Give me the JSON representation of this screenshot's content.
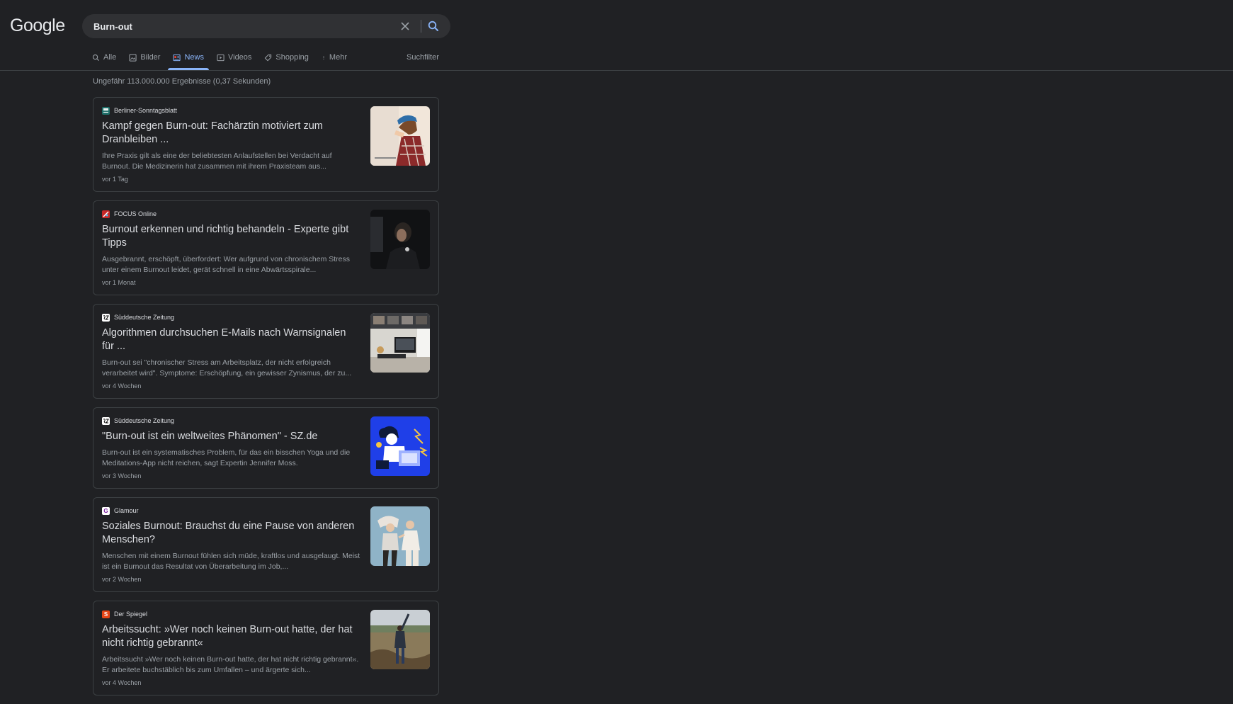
{
  "logo": "Google",
  "search": {
    "value": "Burn-out"
  },
  "tabs": [
    {
      "label": "Alle",
      "icon": "search-icon",
      "active": false
    },
    {
      "label": "Bilder",
      "icon": "image-icon",
      "active": false
    },
    {
      "label": "News",
      "icon": "news-icon",
      "active": true
    },
    {
      "label": "Videos",
      "icon": "play-icon",
      "active": false
    },
    {
      "label": "Shopping",
      "icon": "tag-icon",
      "active": false
    },
    {
      "label": "Mehr",
      "icon": "more-vert-icon",
      "active": false
    }
  ],
  "filter_label": "Suchfilter",
  "result_stats": "Ungefähr 113.000.000 Ergebnisse (0,37 Sekunden)",
  "colors": {
    "accent": "#8ab4f8",
    "background": "#202124",
    "card_border": "#3c4043"
  },
  "results": [
    {
      "source": "Berliner-Sonntagsblatt",
      "favicon_color": "#2a6f6a",
      "favicon_glyph": "",
      "title": "Kampf gegen Burn-out: Fachärztin motiviert zum Dranbleiben ...",
      "snippet": "Ihre Praxis gilt als eine der beliebtesten Anlaufstellen bei Verdacht auf Burnout. Die Medizinerin hat zusammen mit ihrem Praxisteam aus...",
      "date": "vor 1 Tag"
    },
    {
      "source": "FOCUS Online",
      "favicon_color": "#c62828",
      "favicon_glyph": "",
      "title": "Burnout erkennen und richtig behandeln - Experte gibt Tipps",
      "snippet": "Ausgebrannt, erschöpft, überfordert: Wer aufgrund von chronischem Stress unter einem Burnout leidet, gerät schnell in eine Abwärtsspirale...",
      "date": "vor 1 Monat"
    },
    {
      "source": "Süddeutsche Zeitung",
      "favicon_color": "#ffffff",
      "favicon_glyph": "",
      "title": "Algorithmen durchsuchen E-Mails nach Warnsignalen für ...",
      "snippet": "Burn-out sei \"chronischer Stress am Arbeitsplatz, der nicht erfolgreich verarbeitet wird\". Symptome: Erschöpfung, ein gewisser Zynismus, der zu...",
      "date": "vor 4 Wochen"
    },
    {
      "source": "Süddeutsche Zeitung",
      "favicon_color": "#ffffff",
      "favicon_glyph": "",
      "title": "\"Burn-out ist ein weltweites Phänomen\" - SZ.de",
      "snippet": "Burn-out ist ein systematisches Problem, für das ein bisschen Yoga und die Meditations-App nicht reichen, sagt Expertin Jennifer Moss.",
      "date": "vor 3 Wochen"
    },
    {
      "source": "Glamour",
      "favicon_color": "#ffffff",
      "favicon_glyph": "G",
      "title": "Soziales Burnout: Brauchst du eine Pause von anderen Menschen?",
      "snippet": "Menschen mit einem Burnout fühlen sich müde, kraftlos und ausgelaugt. Meist ist ein Burnout das Resultat von Überarbeitung im Job,...",
      "date": "vor 2 Wochen"
    },
    {
      "source": "Der Spiegel",
      "favicon_color": "#e64415",
      "favicon_glyph": "S",
      "title": "Arbeitssucht: »Wer noch keinen Burn-out hatte, der hat nicht richtig gebrannt«",
      "snippet": "Arbeitssucht »Wer noch keinen Burn-out hatte, der hat nicht richtig gebrannt«. Er arbeitete buchstäblich bis zum Umfallen – und ärgerte sich...",
      "date": "vor 4 Wochen"
    }
  ]
}
